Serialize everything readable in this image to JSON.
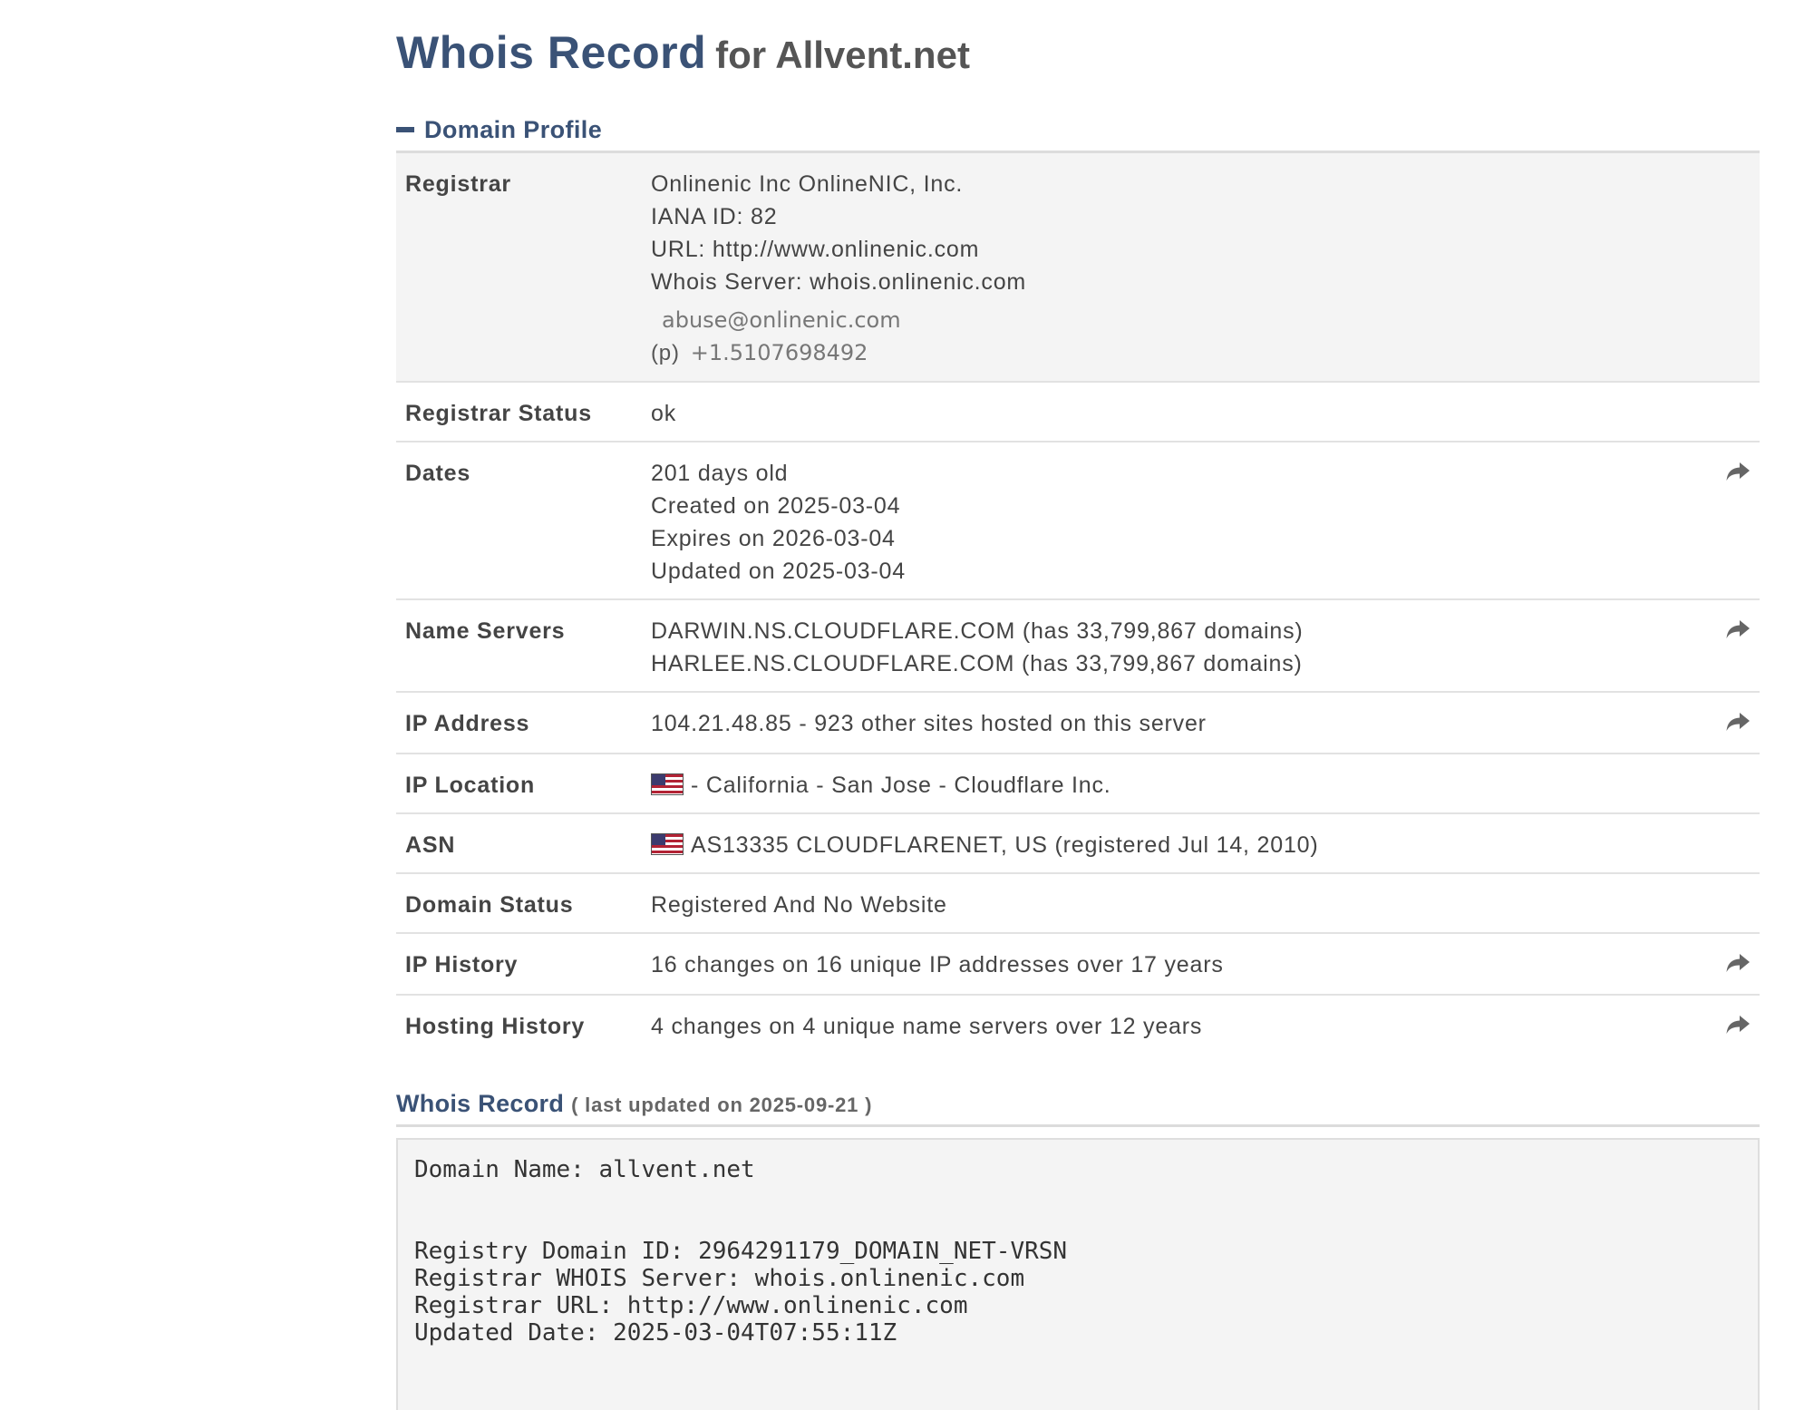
{
  "page": {
    "title_main": "Whois Record",
    "title_sub": "for Allvent.net"
  },
  "domain_profile": {
    "heading": "Domain Profile",
    "registrar": {
      "label": "Registrar",
      "name": "Onlinenic Inc OnlineNIC, Inc.",
      "iana": "IANA ID: 82",
      "url": "URL: http://www.onlinenic.com",
      "whois_server": "Whois Server: whois.onlinenic.com",
      "email": "abuse@onlinenic.com",
      "phone_prefix": "(p)",
      "phone": "+1.5107698492"
    },
    "registrar_status": {
      "label": "Registrar Status",
      "value": "ok"
    },
    "dates": {
      "label": "Dates",
      "age": "201 days old",
      "created": "Created on 2025-03-04",
      "expires": "Expires on 2026-03-04",
      "updated": "Updated on 2025-03-04"
    },
    "name_servers": {
      "label": "Name Servers",
      "ns1": "DARWIN.NS.CLOUDFLARE.COM (has 33,799,867 domains)",
      "ns2": "HARLEE.NS.CLOUDFLARE.COM (has 33,799,867 domains)"
    },
    "ip_address": {
      "label": "IP Address",
      "value": "104.21.48.85 - 923 other sites hosted on this server"
    },
    "ip_location": {
      "label": "IP Location",
      "value": "- California - San Jose - Cloudflare Inc."
    },
    "asn": {
      "label": "ASN",
      "value": "AS13335 CLOUDFLARENET, US (registered Jul 14, 2010)"
    },
    "domain_status": {
      "label": "Domain Status",
      "value": "Registered And No Website"
    },
    "ip_history": {
      "label": "IP History",
      "value": "16 changes on 16 unique IP addresses over 17 years"
    },
    "hosting_history": {
      "label": "Hosting History",
      "value": "4 changes on 4 unique name servers over 12 years"
    }
  },
  "whois_record": {
    "title": "Whois Record",
    "updated": "( last updated on 2025-09-21 )",
    "lines": [
      "Domain Name: allvent.net",
      "",
      "",
      "Registry Domain ID: 2964291179_DOMAIN_NET-VRSN",
      "Registrar WHOIS Server: whois.onlinenic.com",
      "Registrar URL: http://www.onlinenic.com",
      "Updated Date: 2025-03-04T07:55:11Z"
    ]
  },
  "icons": {
    "share": "share-arrow-icon",
    "collapse": "minus-icon",
    "flag": "us-flag-icon"
  },
  "colors": {
    "heading": "#3a5276",
    "row_highlight": "#f4f4f4",
    "border": "#e2e2e2"
  }
}
